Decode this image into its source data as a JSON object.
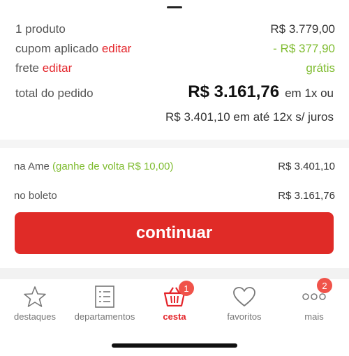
{
  "summary": {
    "product_label": "1 produto",
    "product_value": "R$ 3.779,00",
    "coupon_label": "cupom aplicado",
    "coupon_edit": "editar",
    "coupon_value": "- R$ 377,90",
    "shipping_label": "frete",
    "shipping_edit": "editar",
    "shipping_value": "grátis",
    "total_label": "total do pedido",
    "total_value": "R$ 3.161,76",
    "total_suffix": "em 1x ou",
    "installments": "R$ 3.401,10 em até 12x s/ juros"
  },
  "payment": {
    "ame_label": "na Ame",
    "ame_cashback": "(ganhe de volta R$ 10,00)",
    "ame_price": "R$ 3.401,10",
    "boleto_label": "no boleto",
    "boleto_price": "R$ 3.161,76"
  },
  "cta": {
    "label": "continuar"
  },
  "tabbar": {
    "items": [
      {
        "label": "destaques",
        "icon": "star-icon"
      },
      {
        "label": "departamentos",
        "icon": "list-icon"
      },
      {
        "label": "cesta",
        "icon": "basket-icon",
        "badge": "1",
        "active": true
      },
      {
        "label": "favoritos",
        "icon": "heart-icon"
      },
      {
        "label": "mais",
        "icon": "more-icon",
        "badge": "2"
      }
    ]
  },
  "colors": {
    "accent": "#e02b27",
    "green": "#7fbc30",
    "badge": "#f0534a"
  }
}
